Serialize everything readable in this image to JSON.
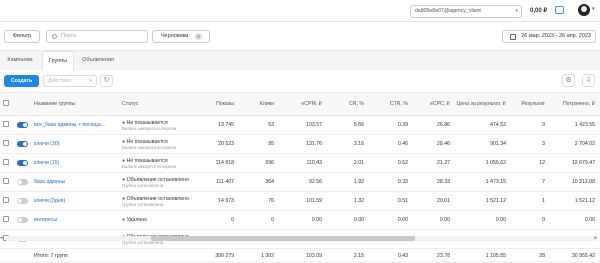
{
  "header": {
    "account": "da905e8e07@agency_client",
    "balance": "0,00 ₽",
    "account_chevron": "▾",
    "avatar_chevron": "▾"
  },
  "toolbar": {
    "filter_label": "Фильтр",
    "search_placeholder": "Поиск",
    "drafts_label": "Черновики",
    "drafts_count": "0",
    "date_range": "26 мар. 2023 - 26 апр. 2023"
  },
  "tabs": [
    {
      "label": "Кампании",
      "active": false
    },
    {
      "label": "Группы",
      "active": true
    },
    {
      "label": "Объявления",
      "active": false
    }
  ],
  "actions": {
    "create_label": "Создать",
    "actions_placeholder": "Действия",
    "refresh_icon": "↻",
    "settings_icon": "⚙",
    "download_icon": "⇩"
  },
  "table": {
    "headers": [
      "Название группы",
      "Статус",
      "Показы",
      "Клики",
      "eCPM, ₽",
      "CR, %",
      "CTR, %",
      "eCPC, ₽",
      "Цена за результат, ₽",
      "Результат",
      "Потрачено, ₽"
    ],
    "rows": [
      {
        "toggle": "on",
        "name": "все_база админы + посеща...",
        "status": "Не показывается",
        "status_sub": "Баланс аккаунта исчерпан",
        "impressions": "13 745",
        "clicks": "53",
        "ecpm": "103.57",
        "cr": "5.66",
        "ctr": "0.39",
        "ecpc": "26.86",
        "cost_per_result": "474.52",
        "result": "3",
        "spent": "1 423.55"
      },
      {
        "toggle": "on",
        "name": "ключи (30)",
        "status": "Не показывается",
        "status_sub": "Баланс аккаунта исчерпан",
        "impressions": "20 523",
        "clicks": "95",
        "ecpm": "131.76",
        "cr": "3.16",
        "ctr": "0.46",
        "ecpc": "28.46",
        "cost_per_result": "901.34",
        "result": "3",
        "spent": "2 704.02"
      },
      {
        "toggle": "on",
        "name": "ключи (15)",
        "status": "Не показывается",
        "status_sub": "Баланс аккаунта исчерпан",
        "impressions": "114 818",
        "clicks": "596",
        "ecpm": "110.43",
        "cr": "2.01",
        "ctr": "0.52",
        "ecpc": "21.27",
        "cost_per_result": "1 056.62",
        "result": "12",
        "spent": "12 679.47"
      },
      {
        "toggle": "off",
        "name": "база админы",
        "status": "Объявление остановлено",
        "status_sub": "Группа остановлена",
        "impressions": "111 407",
        "clicks": "364",
        "ecpm": "92.56",
        "cr": "1.92",
        "ctr": "0.33",
        "ecpc": "28.33",
        "cost_per_result": "1 473.15",
        "result": "7",
        "spent": "10 312.08"
      },
      {
        "toggle": "off",
        "name": "ключи (3дня)",
        "status": "Объявление остановлено",
        "status_sub": "Группа остановлена",
        "impressions": "14 973",
        "clicks": "76",
        "ecpm": "101.59",
        "cr": "1.32",
        "ctr": "0.51",
        "ecpc": "20.01",
        "cost_per_result": "1 521.12",
        "result": "1",
        "spent": "1 521.12"
      },
      {
        "toggle": "off",
        "name": "интересы",
        "status": "Удалено",
        "status_sub": "",
        "impressions": "0",
        "clicks": "0",
        "ecpm": "0.00",
        "cr": "0.00",
        "ctr": "0.00",
        "ecpc": "0.00",
        "cost_per_result": "0.00",
        "result": "0",
        "spent": "0.00"
      },
      {
        "toggle": "off",
        "name": "ключи",
        "status": "Объявление остановлено",
        "status_sub": "Группа остановлена",
        "impressions": "24 813",
        "clicks": "118",
        "ecpm": "93.31",
        "cr": "1.69",
        "ctr": "0.48",
        "ecpc": "19.62",
        "cost_per_result": "1 157.59",
        "result": "2",
        "spent": "2 315.19"
      }
    ],
    "footer": {
      "label": "Итого: 7 групп",
      "impressions": "300 279",
      "clicks": "1 302",
      "ecpm": "103.09",
      "cr": "2.15",
      "ctr": "0.43",
      "ecpc": "23.78",
      "cost_per_result": "1 105.55",
      "result": "28",
      "spent": "30 955.42"
    }
  },
  "scroll": {
    "left_arrow": "◂",
    "right_arrow": "▸"
  }
}
